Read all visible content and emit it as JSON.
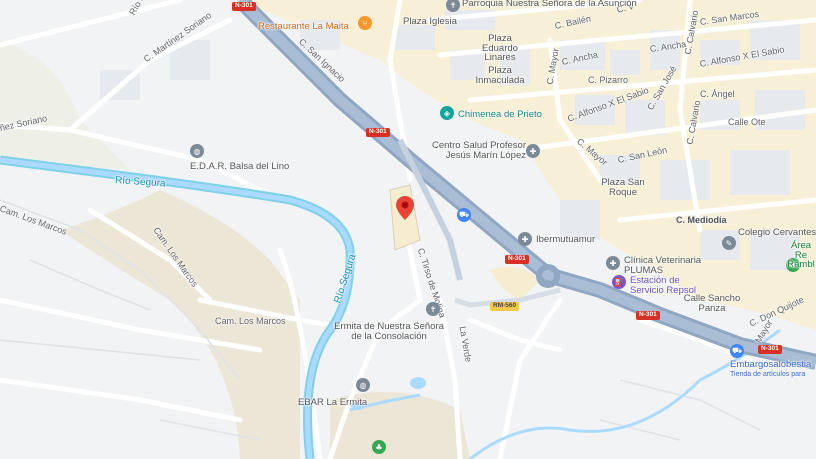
{
  "map": {
    "roads": {
      "n301": "N-301",
      "rm560": "RM-560",
      "san_ignacio": "C. San Ignacio",
      "martinez_soriano": "C. Martínez Soriano",
      "martinez_soriano_left": "ñez Soriano",
      "segura_top": "Río Segura",
      "balen": "C. Bailén",
      "c_v": "C. V",
      "san_marcos": "C. San Marcos",
      "calvario_top": "C. Calvario",
      "ancha_top": "C. Ancha",
      "ancha": "C. Ancha",
      "alfonso_top": "C. Alfonso X El Sabio",
      "mayor_top": "C. Mayor",
      "pizarro": "C. Pizarro",
      "angel": "C. Ángel",
      "alfonso": "C. Alfonso X El Sabio",
      "san_jose": "C. San José",
      "calvario": "C. Calvario",
      "calle_ote": "Calle Ote",
      "mayor": "C. Mayor",
      "san_leon": "C. San León",
      "mediodia": "C. Mediodía",
      "tirso": "C. Tirso de Molina",
      "cam_los_marcos_1": "Cam. Los Marcos",
      "cam_los_marcos_2": "Cam. Los Marcos",
      "cam_los_marcos_3": "Cam. Los Marcos",
      "la_verde": "La Verde",
      "don_quijote": "C. Don Quijote",
      "mayor_bottom": "Mayor",
      "rio_segura_main": "Río Segura",
      "rio_segura_vertical": "Río Segura"
    },
    "places": {
      "parroquia": "Parroquia Nuestra Señora de la Asunción",
      "restaurante": "Restaurante La Maita",
      "plaza_iglesia": "Plaza Iglesia",
      "plaza_eduardo": "Plaza Eduardo Linares",
      "plaza_inmaculada": "Plaza Inmaculada",
      "chimenea": "Chimenea de Prieto",
      "centro_salud": "Centro Salud Profesor Jesús Marín López",
      "edar": "E.D.A.R. Balsa del Lino",
      "plaza_san_roque": "Plaza San Roque",
      "ibermutuamur": "Ibermutuamur",
      "colegio": "Colegio Cervantes",
      "area_recreativa": "Área Re Rambl",
      "clinica": "Clínica Veterinaria PLUMAS",
      "estacion": "Estación de Servicio Repsol",
      "calle_sancho": "Calle Sancho Panza",
      "ermita": "Ermita de Nuestra Señora de la Consolación",
      "ebar": "EBAR La Ermita",
      "embargos": "Embargosalobestia",
      "embargos_sub": "Tienda de artículos para"
    },
    "colors": {
      "background": "#f1f3f4",
      "highway": "#8fa7c2",
      "water": "#aadaff",
      "river": "#7fd1e8",
      "urban": "#f8edc5",
      "marker_red": "#ea4335"
    }
  }
}
